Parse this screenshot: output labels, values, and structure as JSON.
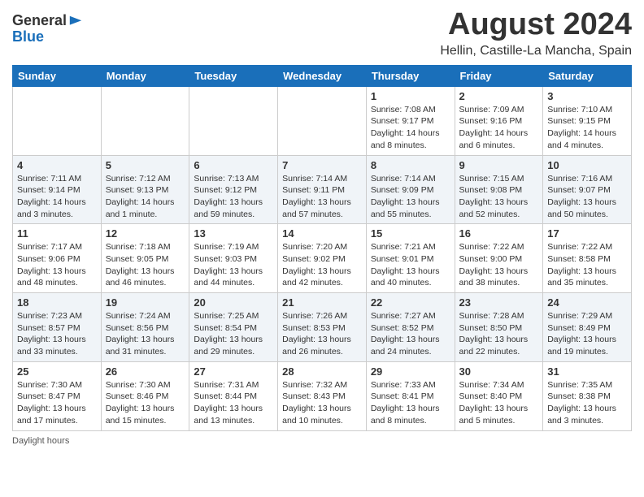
{
  "header": {
    "logo_general": "General",
    "logo_blue": "Blue",
    "month_year": "August 2024",
    "location": "Hellin, Castille-La Mancha, Spain"
  },
  "calendar": {
    "days_of_week": [
      "Sunday",
      "Monday",
      "Tuesday",
      "Wednesday",
      "Thursday",
      "Friday",
      "Saturday"
    ],
    "weeks": [
      {
        "days": [
          {
            "number": "",
            "info": ""
          },
          {
            "number": "",
            "info": ""
          },
          {
            "number": "",
            "info": ""
          },
          {
            "number": "",
            "info": ""
          },
          {
            "number": "1",
            "info": "Sunrise: 7:08 AM\nSunset: 9:17 PM\nDaylight: 14 hours\nand 8 minutes."
          },
          {
            "number": "2",
            "info": "Sunrise: 7:09 AM\nSunset: 9:16 PM\nDaylight: 14 hours\nand 6 minutes."
          },
          {
            "number": "3",
            "info": "Sunrise: 7:10 AM\nSunset: 9:15 PM\nDaylight: 14 hours\nand 4 minutes."
          }
        ]
      },
      {
        "days": [
          {
            "number": "4",
            "info": "Sunrise: 7:11 AM\nSunset: 9:14 PM\nDaylight: 14 hours\nand 3 minutes."
          },
          {
            "number": "5",
            "info": "Sunrise: 7:12 AM\nSunset: 9:13 PM\nDaylight: 14 hours\nand 1 minute."
          },
          {
            "number": "6",
            "info": "Sunrise: 7:13 AM\nSunset: 9:12 PM\nDaylight: 13 hours\nand 59 minutes."
          },
          {
            "number": "7",
            "info": "Sunrise: 7:14 AM\nSunset: 9:11 PM\nDaylight: 13 hours\nand 57 minutes."
          },
          {
            "number": "8",
            "info": "Sunrise: 7:14 AM\nSunset: 9:09 PM\nDaylight: 13 hours\nand 55 minutes."
          },
          {
            "number": "9",
            "info": "Sunrise: 7:15 AM\nSunset: 9:08 PM\nDaylight: 13 hours\nand 52 minutes."
          },
          {
            "number": "10",
            "info": "Sunrise: 7:16 AM\nSunset: 9:07 PM\nDaylight: 13 hours\nand 50 minutes."
          }
        ]
      },
      {
        "days": [
          {
            "number": "11",
            "info": "Sunrise: 7:17 AM\nSunset: 9:06 PM\nDaylight: 13 hours\nand 48 minutes."
          },
          {
            "number": "12",
            "info": "Sunrise: 7:18 AM\nSunset: 9:05 PM\nDaylight: 13 hours\nand 46 minutes."
          },
          {
            "number": "13",
            "info": "Sunrise: 7:19 AM\nSunset: 9:03 PM\nDaylight: 13 hours\nand 44 minutes."
          },
          {
            "number": "14",
            "info": "Sunrise: 7:20 AM\nSunset: 9:02 PM\nDaylight: 13 hours\nand 42 minutes."
          },
          {
            "number": "15",
            "info": "Sunrise: 7:21 AM\nSunset: 9:01 PM\nDaylight: 13 hours\nand 40 minutes."
          },
          {
            "number": "16",
            "info": "Sunrise: 7:22 AM\nSunset: 9:00 PM\nDaylight: 13 hours\nand 38 minutes."
          },
          {
            "number": "17",
            "info": "Sunrise: 7:22 AM\nSunset: 8:58 PM\nDaylight: 13 hours\nand 35 minutes."
          }
        ]
      },
      {
        "days": [
          {
            "number": "18",
            "info": "Sunrise: 7:23 AM\nSunset: 8:57 PM\nDaylight: 13 hours\nand 33 minutes."
          },
          {
            "number": "19",
            "info": "Sunrise: 7:24 AM\nSunset: 8:56 PM\nDaylight: 13 hours\nand 31 minutes."
          },
          {
            "number": "20",
            "info": "Sunrise: 7:25 AM\nSunset: 8:54 PM\nDaylight: 13 hours\nand 29 minutes."
          },
          {
            "number": "21",
            "info": "Sunrise: 7:26 AM\nSunset: 8:53 PM\nDaylight: 13 hours\nand 26 minutes."
          },
          {
            "number": "22",
            "info": "Sunrise: 7:27 AM\nSunset: 8:52 PM\nDaylight: 13 hours\nand 24 minutes."
          },
          {
            "number": "23",
            "info": "Sunrise: 7:28 AM\nSunset: 8:50 PM\nDaylight: 13 hours\nand 22 minutes."
          },
          {
            "number": "24",
            "info": "Sunrise: 7:29 AM\nSunset: 8:49 PM\nDaylight: 13 hours\nand 19 minutes."
          }
        ]
      },
      {
        "days": [
          {
            "number": "25",
            "info": "Sunrise: 7:30 AM\nSunset: 8:47 PM\nDaylight: 13 hours\nand 17 minutes."
          },
          {
            "number": "26",
            "info": "Sunrise: 7:30 AM\nSunset: 8:46 PM\nDaylight: 13 hours\nand 15 minutes."
          },
          {
            "number": "27",
            "info": "Sunrise: 7:31 AM\nSunset: 8:44 PM\nDaylight: 13 hours\nand 13 minutes."
          },
          {
            "number": "28",
            "info": "Sunrise: 7:32 AM\nSunset: 8:43 PM\nDaylight: 13 hours\nand 10 minutes."
          },
          {
            "number": "29",
            "info": "Sunrise: 7:33 AM\nSunset: 8:41 PM\nDaylight: 13 hours\nand 8 minutes."
          },
          {
            "number": "30",
            "info": "Sunrise: 7:34 AM\nSunset: 8:40 PM\nDaylight: 13 hours\nand 5 minutes."
          },
          {
            "number": "31",
            "info": "Sunrise: 7:35 AM\nSunset: 8:38 PM\nDaylight: 13 hours\nand 3 minutes."
          }
        ]
      }
    ]
  },
  "footer": {
    "note": "Daylight hours"
  }
}
